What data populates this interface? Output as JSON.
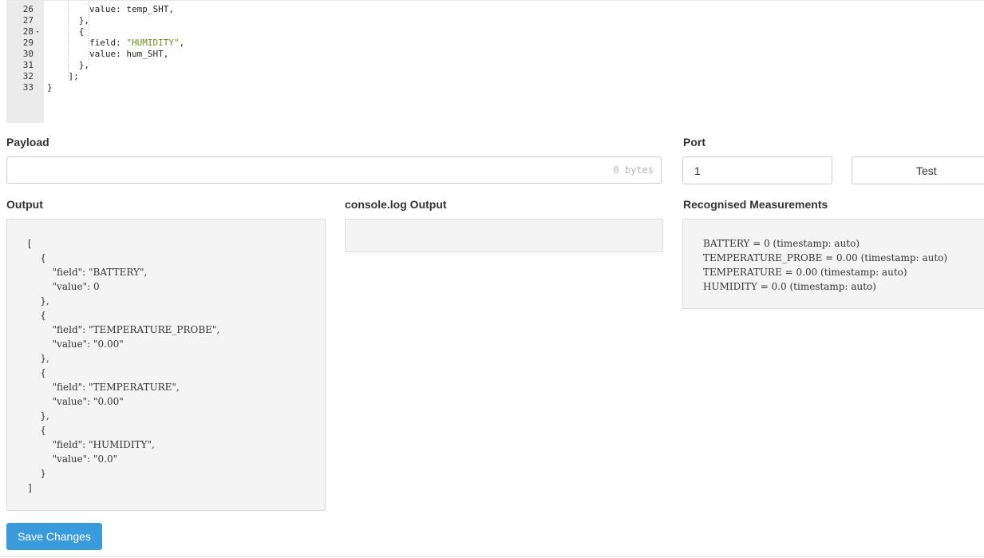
{
  "editor": {
    "lines": [
      {
        "num": "26",
        "fold": "",
        "code": [
          {
            "t": "        value: temp_SHT,"
          }
        ]
      },
      {
        "num": "27",
        "fold": "",
        "code": [
          {
            "t": "      },"
          }
        ]
      },
      {
        "num": "28",
        "fold": "▾",
        "code": [
          {
            "t": "      {"
          }
        ]
      },
      {
        "num": "29",
        "fold": "",
        "code": [
          {
            "t": "        field: "
          },
          {
            "t": "\"HUMIDITY\"",
            "s": 1
          },
          {
            "t": ","
          }
        ]
      },
      {
        "num": "30",
        "fold": "",
        "code": [
          {
            "t": "        value: hum_SHT,"
          }
        ]
      },
      {
        "num": "31",
        "fold": "",
        "code": [
          {
            "t": "      },"
          }
        ]
      },
      {
        "num": "32",
        "fold": "",
        "code": [
          {
            "t": "    ];"
          }
        ]
      },
      {
        "num": "33",
        "fold": "",
        "code": [
          {
            "t": "}"
          }
        ]
      }
    ]
  },
  "payload": {
    "label": "Payload",
    "value": "",
    "size": "0 bytes"
  },
  "port": {
    "label": "Port",
    "value": "1"
  },
  "test_button": "Test",
  "output": {
    "label": "Output",
    "text": "[\n    {\n        \"field\": \"BATTERY\",\n        \"value\": 0\n    },\n    {\n        \"field\": \"TEMPERATURE_PROBE\",\n        \"value\": \"0.00\"\n    },\n    {\n        \"field\": \"TEMPERATURE\",\n        \"value\": \"0.00\"\n    },\n    {\n        \"field\": \"HUMIDITY\",\n        \"value\": \"0.0\"\n    }\n]"
  },
  "console": {
    "label": "console.log Output",
    "text": ""
  },
  "recognised": {
    "label": "Recognised Measurements",
    "lines": [
      "BATTERY = 0 (timestamp: auto)",
      "TEMPERATURE_PROBE = 0.00 (timestamp: auto)",
      "TEMPERATURE = 0.00 (timestamp: auto)",
      "HUMIDITY = 0.0 (timestamp: auto)"
    ]
  },
  "save_button": "Save Changes"
}
